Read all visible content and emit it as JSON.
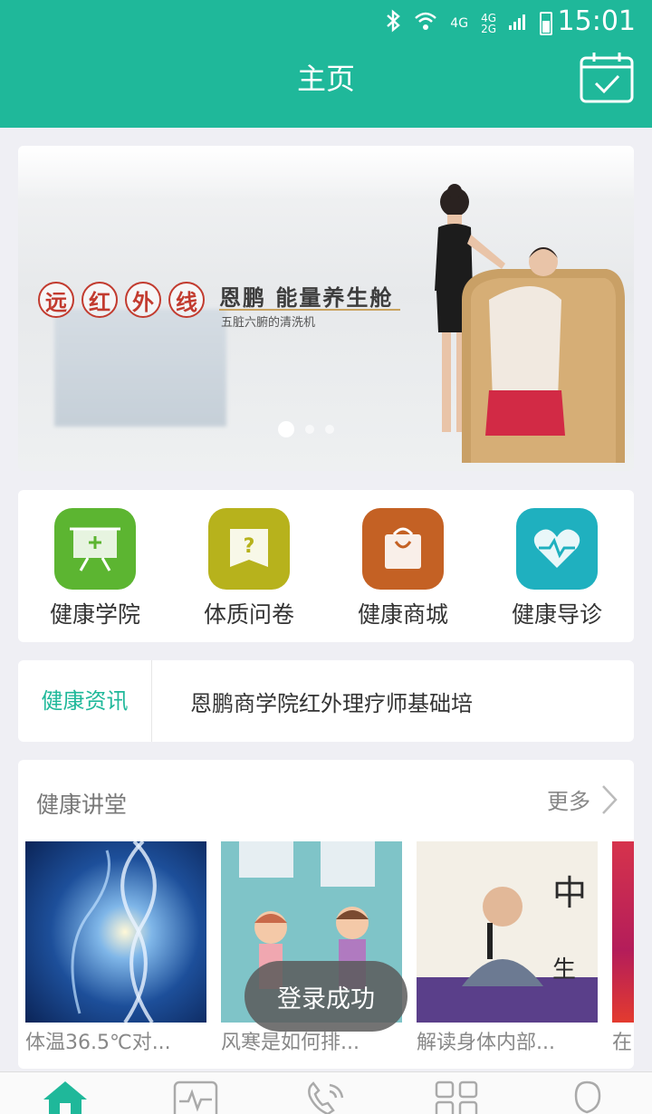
{
  "status_bar": {
    "time": "15:01",
    "net1": "4G",
    "net2": "4G",
    "net3": "2G"
  },
  "header": {
    "title": "主页"
  },
  "banner": {
    "tags": [
      "远",
      "红",
      "外",
      "线"
    ],
    "title": "恩鹏 能量养生舱",
    "subtitle": "五脏六腑的清洗机",
    "active_slide": 1,
    "slide_count": 3
  },
  "menu": [
    {
      "label": "健康学院",
      "icon": "presentation-board-icon",
      "color": "#5cb531"
    },
    {
      "label": "体质问卷",
      "icon": "questionnaire-book-icon",
      "color": "#b7b21c"
    },
    {
      "label": "健康商城",
      "icon": "shopping-bag-icon",
      "color": "#c46124"
    },
    {
      "label": "健康导诊",
      "icon": "heart-pulse-icon",
      "color": "#1fb0bf"
    }
  ],
  "news": {
    "tag": "健康资讯",
    "headline": "恩鹏商学院红外理疗师基础培"
  },
  "lectures": {
    "title": "健康讲堂",
    "more": "更多",
    "items": [
      {
        "caption": "体温36.5℃对..."
      },
      {
        "caption": "风寒是如何排..."
      },
      {
        "caption": "解读身体内部..."
      },
      {
        "caption": "在"
      }
    ]
  },
  "toast": "登录成功",
  "bottom_nav": [
    "home-icon",
    "health-monitor-icon",
    "phone-consult-icon",
    "apps-grid-icon",
    "profile-icon"
  ]
}
